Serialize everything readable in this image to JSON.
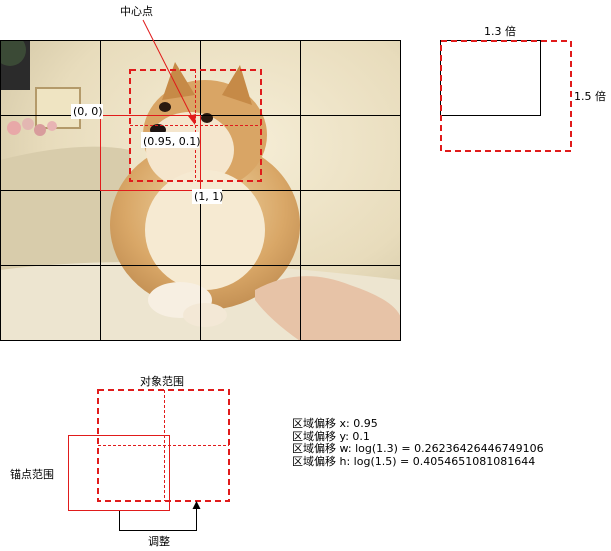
{
  "photo": {
    "description_icon": "shiba-dog-photo",
    "grid": {
      "cols": 4,
      "rows": 4
    }
  },
  "labels": {
    "center": "中心点",
    "top_left": "(0, 0)",
    "center_coord": "(0.95, 0.1)",
    "bottom_right": "(1, 1)",
    "scale_w": "1.3 倍",
    "scale_h": "1.5 倍",
    "object_range": "对象范围",
    "anchor_range": "锚点范围",
    "adjust": "调整"
  },
  "formulas": [
    "区域偏移 x: 0.95",
    "区域偏移 y: 0.1",
    "区域偏移 w: log(1.3) = 0.26236426446749106",
    "区域偏移 h: log(1.5) = 0.4054651081081644"
  ],
  "colors": {
    "accent": "#e01b1b",
    "grid": "#000000"
  }
}
